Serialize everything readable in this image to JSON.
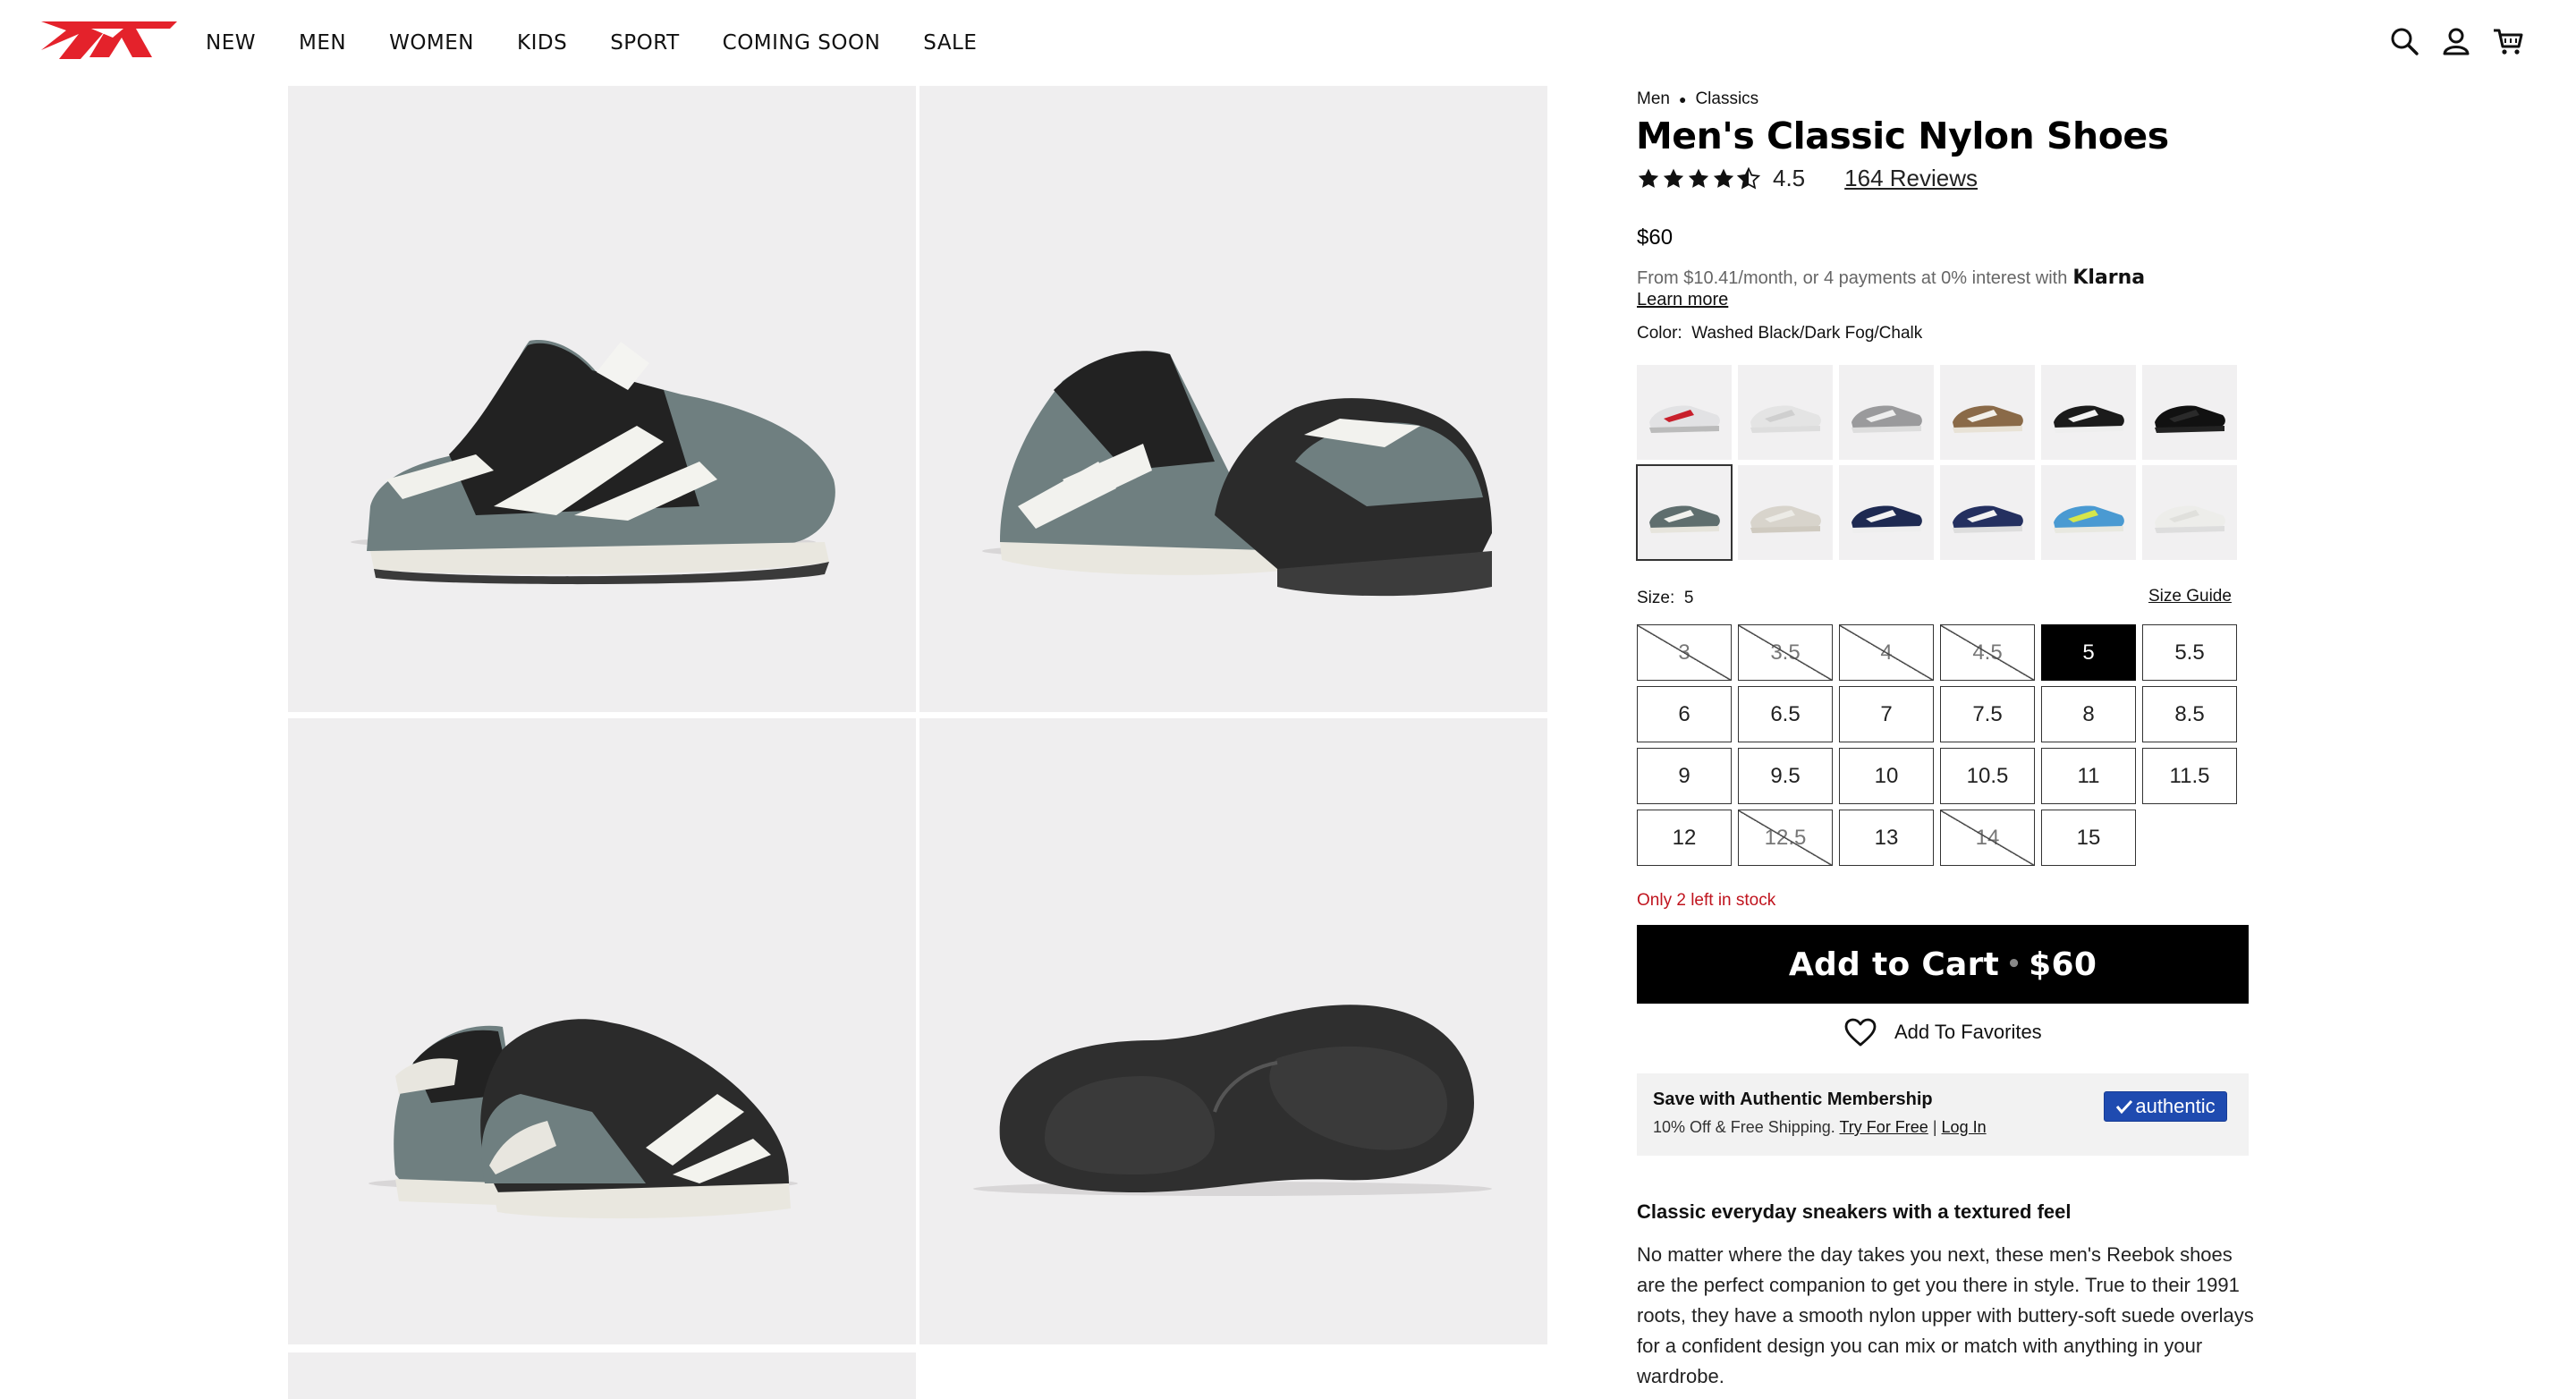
{
  "header": {
    "nav": [
      "NEW",
      "MEN",
      "WOMEN",
      "KIDS",
      "SPORT",
      "COMING SOON",
      "SALE"
    ],
    "icons": [
      "search-icon",
      "account-icon",
      "cart-icon"
    ],
    "brand_color": "#e4222b"
  },
  "product": {
    "breadcrumb": [
      "Men",
      "Classics"
    ],
    "title": "Men's Classic Nylon Shoes",
    "rating": 4.5,
    "rating_text": "4.5",
    "reviews": "164 Reviews",
    "price": "$60",
    "klarna_text": "From $10.41/month, or 4 payments at 0% interest with",
    "klarna_brand": "Klarna",
    "learn_more": "Learn more",
    "color_label": "Color:",
    "color_value": "Washed Black/Dark Fog/Chalk",
    "swatch_count": 12,
    "selected_swatch": 6,
    "size_label": "Size:",
    "size_value": "5",
    "size_guide": "Size Guide",
    "sizes": [
      {
        "label": "3",
        "available": false
      },
      {
        "label": "3.5",
        "available": false
      },
      {
        "label": "4",
        "available": false
      },
      {
        "label": "4.5",
        "available": false
      },
      {
        "label": "5",
        "available": true,
        "selected": true
      },
      {
        "label": "5.5",
        "available": true
      },
      {
        "label": "6",
        "available": true
      },
      {
        "label": "6.5",
        "available": true
      },
      {
        "label": "7",
        "available": true
      },
      {
        "label": "7.5",
        "available": true
      },
      {
        "label": "8",
        "available": true
      },
      {
        "label": "8.5",
        "available": true
      },
      {
        "label": "9",
        "available": true
      },
      {
        "label": "9.5",
        "available": true
      },
      {
        "label": "10",
        "available": true
      },
      {
        "label": "10.5",
        "available": true
      },
      {
        "label": "11",
        "available": true
      },
      {
        "label": "11.5",
        "available": true
      },
      {
        "label": "12",
        "available": true
      },
      {
        "label": "12.5",
        "available": false
      },
      {
        "label": "13",
        "available": true
      },
      {
        "label": "14",
        "available": false
      },
      {
        "label": "15",
        "available": true
      }
    ],
    "stock_note": "Only 2 left in stock",
    "cart_label": "Add to Cart",
    "cart_sep": "•",
    "cart_price": "$60",
    "favorites": "Add To Favorites",
    "membership": {
      "title": "Save with Authentic Membership",
      "text": "10% Off & Free Shipping.",
      "try_link": "Try For Free",
      "divider": "|",
      "login_link": "Log In",
      "badge": "authentic",
      "badge_color": "#1f4bb0"
    },
    "desc_heading": "Classic everyday sneakers with a textured feel",
    "desc_body": "No matter where the day takes you next, these men's Reebok shoes are the perfect companion to get you there in style. True to their 1991 roots, they have a smooth nylon upper with buttery-soft suede overlays for a confident design you can mix or match with anything in your wardrobe."
  }
}
